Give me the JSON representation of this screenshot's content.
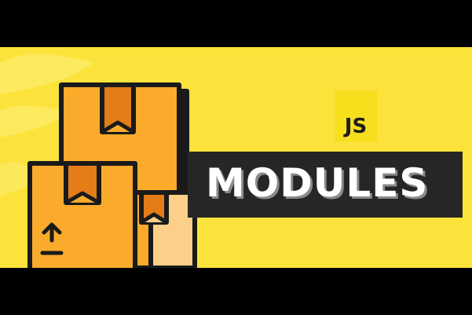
{
  "thumbnail": {
    "badge_text": "JS",
    "title": "MODULES",
    "colors": {
      "background": "#fbe33b",
      "letterbox": "#000000",
      "badge": "#f7df1e",
      "title_bar": "#262626",
      "title_text": "#ffffff",
      "box_orange": "#fbab2c",
      "box_tape": "#e47c18",
      "box_light": "#fdd08a",
      "outline": "#1a1a1a"
    },
    "icons": [
      "stacked-boxes-icon",
      "upload-arrow-icon"
    ]
  }
}
